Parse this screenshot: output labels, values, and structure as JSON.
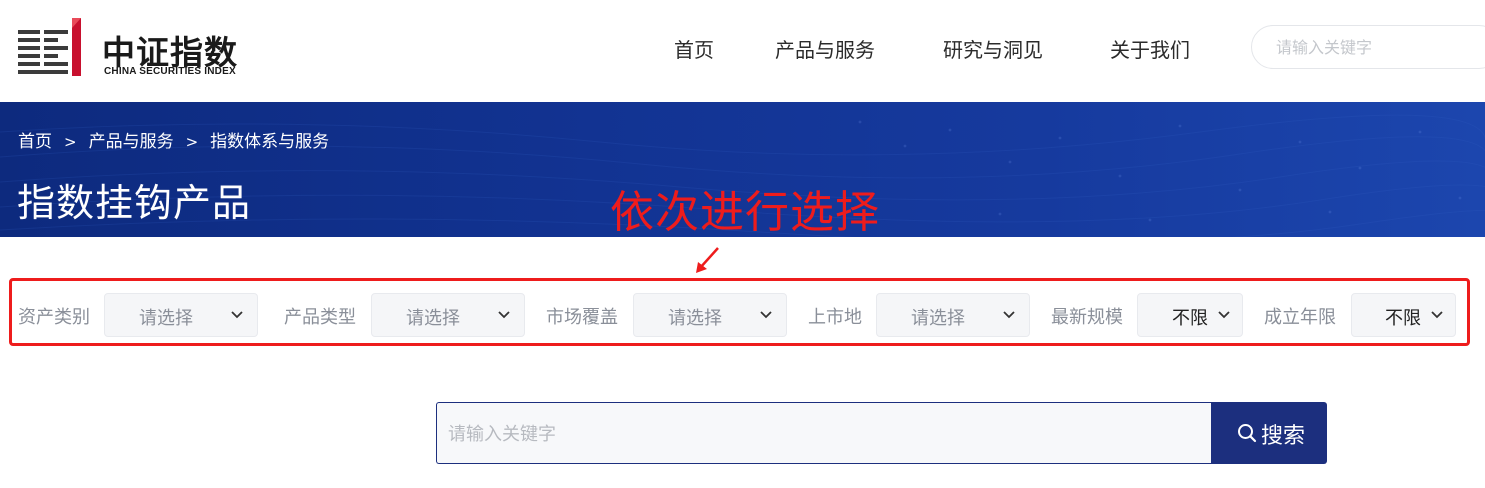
{
  "header": {
    "logo": {
      "cn": "中证指数",
      "en": "CHINA SECURITIES INDEX"
    },
    "nav": [
      "首页",
      "产品与服务",
      "研究与洞见",
      "关于我们"
    ],
    "search_placeholder": "请输入关键字"
  },
  "banner": {
    "breadcrumb": [
      "首页",
      "产品与服务",
      "指数体系与服务"
    ],
    "breadcrumb_separator": ">",
    "title": "指数挂钩产品"
  },
  "annotation": {
    "text": "依次进行选择",
    "color": "#ee1c1c"
  },
  "filters": [
    {
      "label": "资产类别",
      "value": "请选择"
    },
    {
      "label": "产品类型",
      "value": "请选择"
    },
    {
      "label": "市场覆盖",
      "value": "请选择"
    },
    {
      "label": "上市地",
      "value": "请选择"
    },
    {
      "label": "最新规模",
      "value": "不限"
    },
    {
      "label": "成立年限",
      "value": "不限"
    }
  ],
  "search": {
    "placeholder": "请输入关键字",
    "button_label": "搜索"
  },
  "colors": {
    "brand_navy": "#1c2f7e",
    "banner_blue": "#123392",
    "logo_red": "#c8102e"
  },
  "icons": {
    "logo": "csi-logo-mark",
    "select": "chevron-down-icon",
    "search": "search-icon"
  }
}
